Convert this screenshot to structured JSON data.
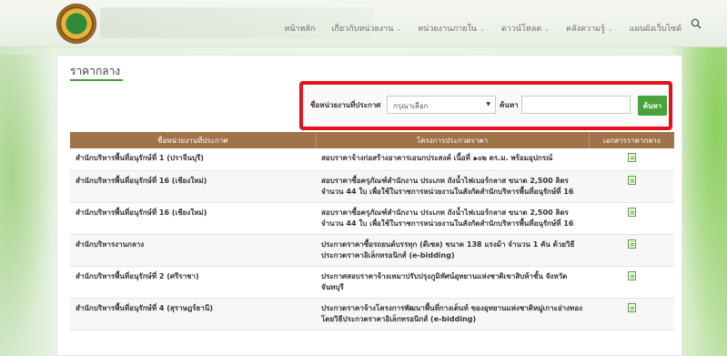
{
  "nav": {
    "items": [
      {
        "label": "หน้าหลัก",
        "dropdown": false
      },
      {
        "label": "เกี่ยวกับหน่วยงาน",
        "dropdown": true
      },
      {
        "label": "หน่วยงานภายใน",
        "dropdown": true
      },
      {
        "label": "ดาวน์โหลด",
        "dropdown": true
      },
      {
        "label": "คลังความรู้",
        "dropdown": true
      },
      {
        "label": "แผนผังเว็บไซต์",
        "dropdown": false
      }
    ],
    "chevron": "⌄",
    "search_icon": "search-icon"
  },
  "page": {
    "title": "ราคากลาง"
  },
  "filter": {
    "agency_label": "ชื่อหน่วยงานที่ประกาศ",
    "select_value": "กรุณาเลือก",
    "keyword_label": "ค้นหา",
    "keyword_value": "",
    "search_button": "ค้นหา",
    "highlight_color": "#e3111b"
  },
  "table": {
    "headers": [
      "ชื่อหน่วยงานที่ประกาศ",
      "โครงการประกวดราคา",
      "เอกสารราคากลาง"
    ],
    "rows": [
      {
        "agency": "สำนักบริหารพื้นที่อนุรักษ์ที่ 1 (ปราจีนบุรี)",
        "project": "สอบราคาจ้างก่อสร้างอาคารเอนกประสงค์ เนื้อที่ ๑๐๒ ตร.ม. พร้อมอุปกรณ์"
      },
      {
        "agency": "สำนักบริหารพื้นที่อนุรักษ์ที่ 16 (เชียงใหม่)",
        "project": "สอบราคาซื้อครุภัณฑ์สำนักงาน ประเภท ถังน้ำไฟเบอร์กลาส ขนาด 2,500 ลิตร จำนวน 44 ใบ เพื่อใช้ในราชการหน่วยงานในสังกัดสำนักบริหารพื้นที่อนุรักษ์ที่ 16"
      },
      {
        "agency": "สำนักบริหารพื้นที่อนุรักษ์ที่ 16 (เชียงใหม่)",
        "project": "สอบราคาซื้อครุภัณฑ์สำนักงาน ประเภท ถังน้ำไฟเบอร์กลาส ขนาด 2,500 ลิตร จำนวน 44 ใบ เพื่อใช้ในราชการหน่วยงานในสังกัดสำนักบริหารพื้นที่อนุรักษ์ที่ 16"
      },
      {
        "agency": "สำนักบริหารงานกลาง",
        "project": "ประกวดราคาซื้อรถยนต์บรรทุก (ดีเซล) ขนาด 138 แรงม้า จำนวน 1 คัน ด้วยวิธีประกวดราคาอิเล็กทรอนิกส์ (e-bidding)"
      },
      {
        "agency": "สำนักบริหารพื้นที่อนุรักษ์ที่ 2 (ศรีราชา)",
        "project": "ประกาศสอบราคาจ้างเหมาปรับปรุงภูมิทัศน์อุทยานแห่งชาติเขาสิบห้าชั้น จังหวัดจันทบุรี"
      },
      {
        "agency": "สำนักบริหารพื้นที่อนุรักษ์ที่ 4 (สุราษฎร์ธานี)",
        "project": "ประกวดราคาจ้างโครงการพัฒนาพื้นที่กางเต็นท์ ของอุทยานแห่งชาติหมู่เกาะอ่างทอง โดยวิธีประกวดราคาอิเล็กทรอนิกส์ (e-bidding)"
      }
    ]
  }
}
